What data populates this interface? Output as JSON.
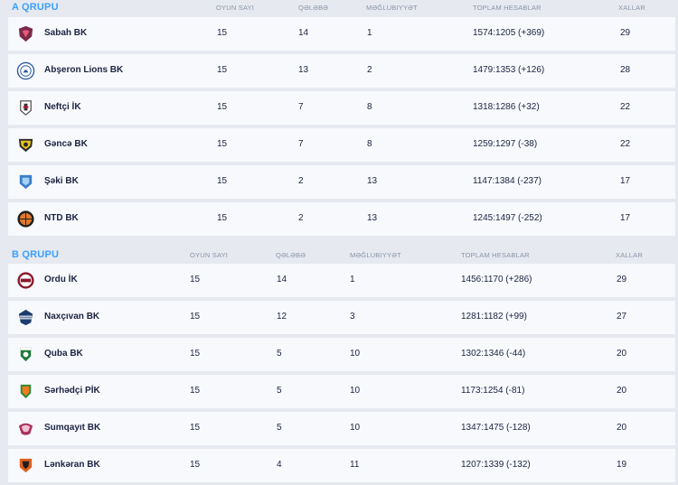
{
  "groups": [
    {
      "title": "A QRUPU",
      "headers": {
        "played": "OYUN SAYI",
        "wins": "QƏLƏBƏ",
        "losses": "MƏĞLUBIYYƏT",
        "points_total": "TOPLAM HESABLAR",
        "points": "XALLAR"
      },
      "rows": [
        {
          "team": "Sabah BK",
          "logo": "sabah-logo-icon",
          "played": "15",
          "wins": "14",
          "losses": "1",
          "score": "1574:1205 (+369)",
          "points": "29"
        },
        {
          "team": "Abşeron Lions BK",
          "logo": "abseron-lions-logo-icon",
          "played": "15",
          "wins": "13",
          "losses": "2",
          "score": "1479:1353 (+126)",
          "points": "28"
        },
        {
          "team": "Neftçi İK",
          "logo": "neftci-logo-icon",
          "played": "15",
          "wins": "7",
          "losses": "8",
          "score": "1318:1286 (+32)",
          "points": "22"
        },
        {
          "team": "Gəncə BK",
          "logo": "gence-logo-icon",
          "played": "15",
          "wins": "7",
          "losses": "8",
          "score": "1259:1297 (-38)",
          "points": "22"
        },
        {
          "team": "Şəki BK",
          "logo": "seki-logo-icon",
          "played": "15",
          "wins": "2",
          "losses": "13",
          "score": "1147:1384 (-237)",
          "points": "17"
        },
        {
          "team": "NTD BK",
          "logo": "ntd-logo-icon",
          "played": "15",
          "wins": "2",
          "losses": "13",
          "score": "1245:1497 (-252)",
          "points": "17"
        }
      ]
    },
    {
      "title": "B QRUPU",
      "headers": {
        "played": "OYUN SAYI",
        "wins": "QƏLƏBƏ",
        "losses": "MƏĞLUBIYYƏT",
        "points_total": "TOPLAM HESABLAR",
        "points": "XALLAR"
      },
      "rows": [
        {
          "team": "Ordu İK",
          "logo": "ordu-logo-icon",
          "played": "15",
          "wins": "14",
          "losses": "1",
          "score": "1456:1170 (+286)",
          "points": "29"
        },
        {
          "team": "Naxçıvan BK",
          "logo": "naxcivan-logo-icon",
          "played": "15",
          "wins": "12",
          "losses": "3",
          "score": "1281:1182 (+99)",
          "points": "27"
        },
        {
          "team": "Quba BK",
          "logo": "quba-logo-icon",
          "played": "15",
          "wins": "5",
          "losses": "10",
          "score": "1302:1346 (-44)",
          "points": "20"
        },
        {
          "team": "Sərhədçi PİK",
          "logo": "serhedci-logo-icon",
          "played": "15",
          "wins": "5",
          "losses": "10",
          "score": "1173:1254 (-81)",
          "points": "20"
        },
        {
          "team": "Sumqayıt BK",
          "logo": "sumqayit-logo-icon",
          "played": "15",
          "wins": "5",
          "losses": "10",
          "score": "1347:1475 (-128)",
          "points": "20"
        },
        {
          "team": "Lənkəran BK",
          "logo": "lenkeran-logo-icon",
          "played": "15",
          "wins": "4",
          "losses": "11",
          "score": "1207:1339 (-132)",
          "points": "19"
        }
      ]
    }
  ]
}
